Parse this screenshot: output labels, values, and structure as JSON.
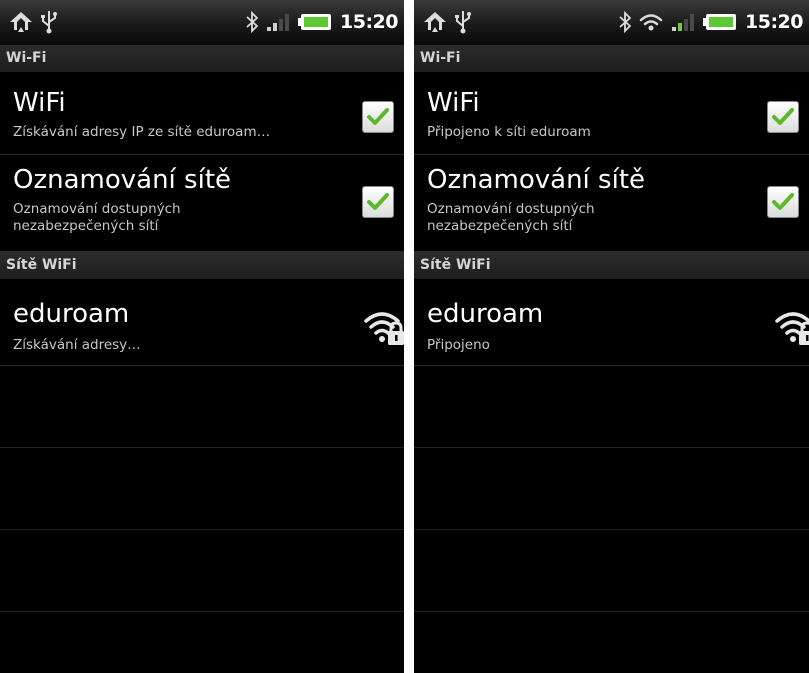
{
  "screens": [
    {
      "status_time": "15:20",
      "section_wifi": "Wi-Fi",
      "wifi_title": "WiFi",
      "wifi_summary": "Získávání adresy IP ze sítě eduroam…",
      "notify_title": "Oznamování sítě",
      "notify_summary_line1": "Oznamování dostupných",
      "notify_summary_line2": "nezabezpečených sítí",
      "section_networks": "Sítě WiFi",
      "network_name": "eduroam",
      "network_status": "Získávání adresy…",
      "wifi_checked": true,
      "notify_checked": true
    },
    {
      "status_time": "15:20",
      "section_wifi": "Wi-Fi",
      "wifi_title": "WiFi",
      "wifi_summary": "Připojeno k síti eduroam",
      "notify_title": "Oznamování sítě",
      "notify_summary_line1": "Oznamování dostupných",
      "notify_summary_line2": "nezabezpečených sítí",
      "section_networks": "Sítě WiFi",
      "network_name": "eduroam",
      "network_status": "Připojeno",
      "wifi_checked": true,
      "notify_checked": true
    }
  ],
  "colors": {
    "background": "#000000",
    "check_green": "#5fb82c",
    "battery_green": "#5ec832",
    "signal_green": "#7cc943",
    "text_primary": "#ffffff",
    "text_secondary": "#c8c8c8"
  },
  "icons": [
    "sync-warning-icon",
    "usb-icon",
    "bluetooth-icon",
    "wifi-status-icon",
    "signal-bars-icon",
    "battery-icon",
    "checkbox-checked-icon",
    "wifi-lock-icon"
  ]
}
